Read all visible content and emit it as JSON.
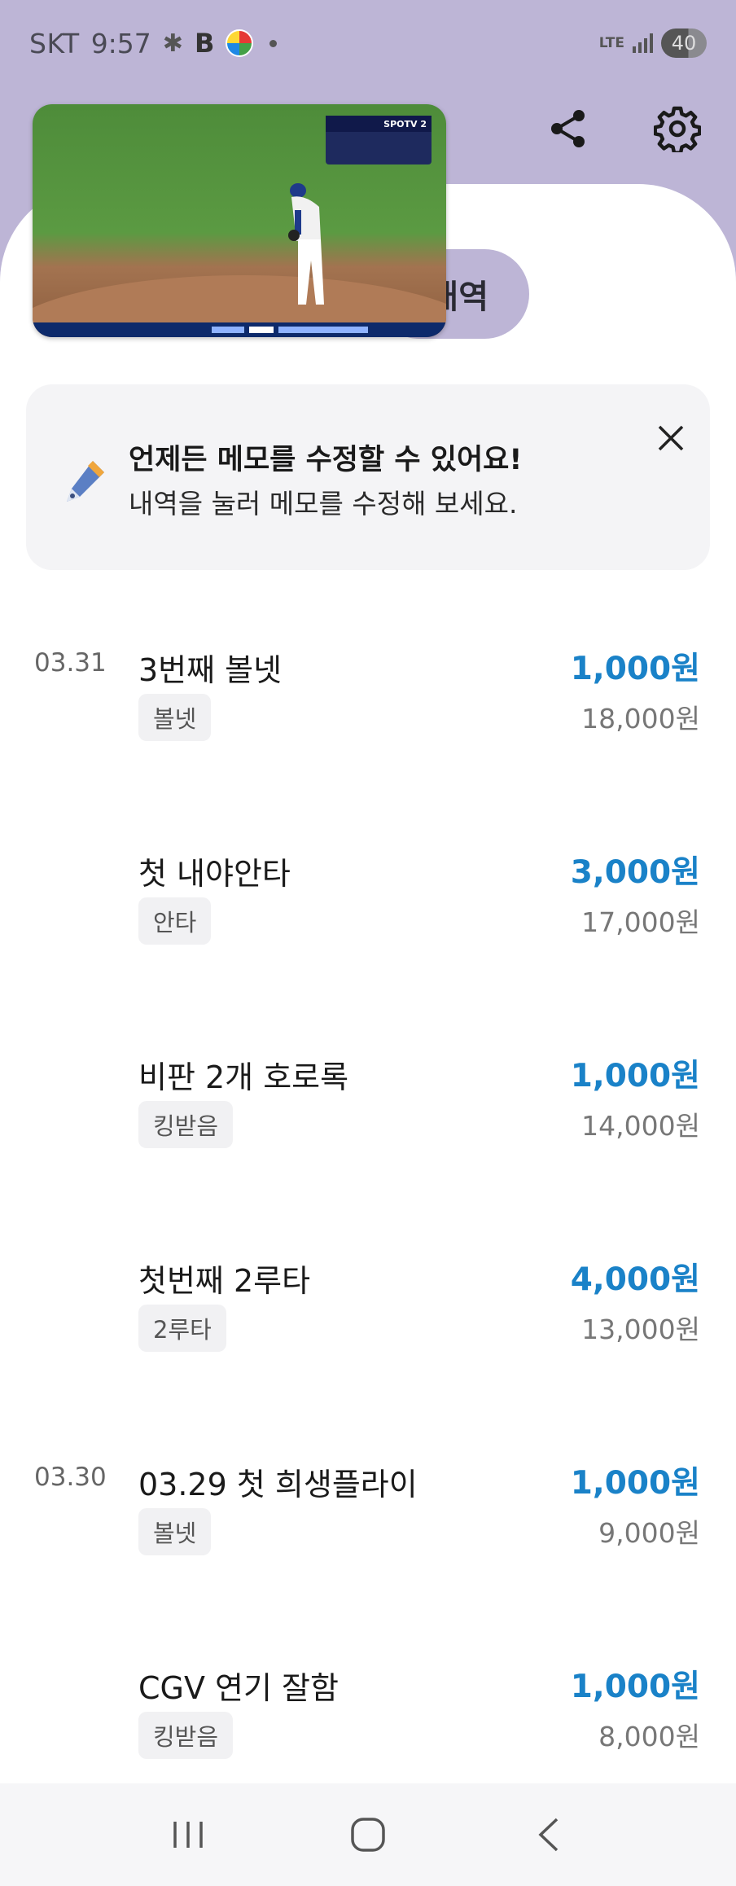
{
  "status_bar": {
    "carrier": "SKT",
    "time": "9:57",
    "network": "LTE",
    "battery": "40"
  },
  "video": {
    "broadcaster": "SPOTV 2"
  },
  "tab": {
    "label": "내역"
  },
  "tip": {
    "title": "언제든 메모를 수정할 수 있어요!",
    "subtitle": "내역을 눌러 메모를 수정해 보세요."
  },
  "history": [
    {
      "date": "03.31",
      "title": "3번째 볼넷",
      "tag": "볼넷",
      "amount": "1,000원",
      "balance": "18,000원"
    },
    {
      "date": "",
      "title": "첫 내야안타",
      "tag": "안타",
      "amount": "3,000원",
      "balance": "17,000원"
    },
    {
      "date": "",
      "title": "비판 2개 호로록",
      "tag": "킹받음",
      "amount": "1,000원",
      "balance": "14,000원"
    },
    {
      "date": "",
      "title": "첫번째 2루타",
      "tag": "2루타",
      "amount": "4,000원",
      "balance": "13,000원"
    },
    {
      "date": "03.30",
      "title": "03.29 첫 희생플라이",
      "tag": "볼넷",
      "amount": "1,000원",
      "balance": "9,000원"
    },
    {
      "date": "",
      "title": "CGV 연기 잘함",
      "tag": "킹받음",
      "amount": "1,000원",
      "balance": "8,000원"
    }
  ],
  "colors": {
    "header_bg": "#bdb5d6",
    "amount": "#1a82c8",
    "card_bg": "#f4f4f6"
  },
  "icons": [
    "share-icon",
    "gear-icon",
    "pen-icon",
    "close-icon",
    "recents-icon",
    "home-icon",
    "back-icon"
  ]
}
